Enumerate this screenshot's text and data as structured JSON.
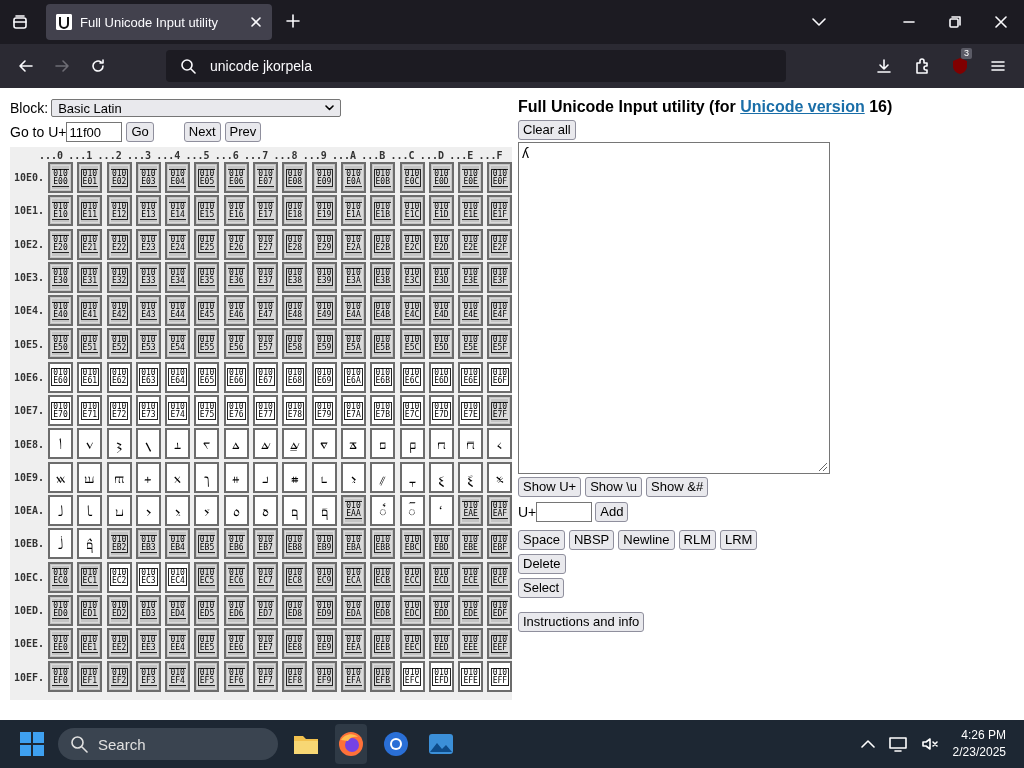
{
  "browser": {
    "tab_title": "Full Unicode Input utility",
    "address": "unicode jkorpela",
    "extension_badge": "3"
  },
  "tool": {
    "block_label": "Block:",
    "block_value": "Basic Latin",
    "goto_label": "Go to U+",
    "goto_value": "11f00",
    "goto_button": "Go",
    "nav_buttons": [
      "Next",
      "Prev"
    ]
  },
  "grid": {
    "columns": [
      "...0",
      "...1",
      "...2",
      "...3",
      "...4",
      "...5",
      "...6",
      "...7",
      "...8",
      "...9",
      "...A",
      "...B",
      "...C",
      "...D",
      "...E",
      "...F"
    ],
    "rows": [
      {
        "label": "10E0.",
        "cells": [
          {
            "kind": "tofu",
            "code": "010E00",
            "assigned": false
          },
          {
            "kind": "tofu",
            "code": "010E01",
            "assigned": false
          },
          {
            "kind": "tofu",
            "code": "010E02",
            "assigned": false
          },
          {
            "kind": "tofu",
            "code": "010E03",
            "assigned": false
          },
          {
            "kind": "tofu",
            "code": "010E04",
            "assigned": false
          },
          {
            "kind": "tofu",
            "code": "010E05",
            "assigned": false
          },
          {
            "kind": "tofu",
            "code": "010E06",
            "assigned": false
          },
          {
            "kind": "tofu",
            "code": "010E07",
            "assigned": false
          },
          {
            "kind": "tofu",
            "code": "010E08",
            "assigned": false
          },
          {
            "kind": "tofu",
            "code": "010E09",
            "assigned": false
          },
          {
            "kind": "tofu",
            "code": "010E0A",
            "assigned": false
          },
          {
            "kind": "tofu",
            "code": "010E0B",
            "assigned": false
          },
          {
            "kind": "tofu",
            "code": "010E0C",
            "assigned": false
          },
          {
            "kind": "tofu",
            "code": "010E0D",
            "assigned": false
          },
          {
            "kind": "tofu",
            "code": "010E0E",
            "assigned": false
          },
          {
            "kind": "tofu",
            "code": "010E0F",
            "assigned": false
          }
        ]
      },
      {
        "label": "10E1.",
        "cells": [
          {
            "kind": "tofu",
            "code": "010E10",
            "assigned": false
          },
          {
            "kind": "tofu",
            "code": "010E11",
            "assigned": false
          },
          {
            "kind": "tofu",
            "code": "010E12",
            "assigned": false
          },
          {
            "kind": "tofu",
            "code": "010E13",
            "assigned": false
          },
          {
            "kind": "tofu",
            "code": "010E14",
            "assigned": false
          },
          {
            "kind": "tofu",
            "code": "010E15",
            "assigned": false
          },
          {
            "kind": "tofu",
            "code": "010E16",
            "assigned": false
          },
          {
            "kind": "tofu",
            "code": "010E17",
            "assigned": false
          },
          {
            "kind": "tofu",
            "code": "010E18",
            "assigned": false
          },
          {
            "kind": "tofu",
            "code": "010E19",
            "assigned": false
          },
          {
            "kind": "tofu",
            "code": "010E1A",
            "assigned": false
          },
          {
            "kind": "tofu",
            "code": "010E1B",
            "assigned": false
          },
          {
            "kind": "tofu",
            "code": "010E1C",
            "assigned": false
          },
          {
            "kind": "tofu",
            "code": "010E1D",
            "assigned": false
          },
          {
            "kind": "tofu",
            "code": "010E1E",
            "assigned": false
          },
          {
            "kind": "tofu",
            "code": "010E1F",
            "assigned": false
          }
        ]
      },
      {
        "label": "10E2.",
        "cells": [
          {
            "kind": "tofu",
            "code": "010E20",
            "assigned": false
          },
          {
            "kind": "tofu",
            "code": "010E21",
            "assigned": false
          },
          {
            "kind": "tofu",
            "code": "010E22",
            "assigned": false
          },
          {
            "kind": "tofu",
            "code": "010E23",
            "assigned": false
          },
          {
            "kind": "tofu",
            "code": "010E24",
            "assigned": false
          },
          {
            "kind": "tofu",
            "code": "010E25",
            "assigned": false
          },
          {
            "kind": "tofu",
            "code": "010E26",
            "assigned": false
          },
          {
            "kind": "tofu",
            "code": "010E27",
            "assigned": false
          },
          {
            "kind": "tofu",
            "code": "010E28",
            "assigned": false
          },
          {
            "kind": "tofu",
            "code": "010E29",
            "assigned": false
          },
          {
            "kind": "tofu",
            "code": "010E2A",
            "assigned": false
          },
          {
            "kind": "tofu",
            "code": "010E2B",
            "assigned": false
          },
          {
            "kind": "tofu",
            "code": "010E2C",
            "assigned": false
          },
          {
            "kind": "tofu",
            "code": "010E2D",
            "assigned": false
          },
          {
            "kind": "tofu",
            "code": "010E2E",
            "assigned": false
          },
          {
            "kind": "tofu",
            "code": "010E2F",
            "assigned": false
          }
        ]
      },
      {
        "label": "10E3.",
        "cells": [
          {
            "kind": "tofu",
            "code": "010E30",
            "assigned": false
          },
          {
            "kind": "tofu",
            "code": "010E31",
            "assigned": false
          },
          {
            "kind": "tofu",
            "code": "010E32",
            "assigned": false
          },
          {
            "kind": "tofu",
            "code": "010E33",
            "assigned": false
          },
          {
            "kind": "tofu",
            "code": "010E34",
            "assigned": false
          },
          {
            "kind": "tofu",
            "code": "010E35",
            "assigned": false
          },
          {
            "kind": "tofu",
            "code": "010E36",
            "assigned": false
          },
          {
            "kind": "tofu",
            "code": "010E37",
            "assigned": false
          },
          {
            "kind": "tofu",
            "code": "010E38",
            "assigned": false
          },
          {
            "kind": "tofu",
            "code": "010E39",
            "assigned": false
          },
          {
            "kind": "tofu",
            "code": "010E3A",
            "assigned": false
          },
          {
            "kind": "tofu",
            "code": "010E3B",
            "assigned": false
          },
          {
            "kind": "tofu",
            "code": "010E3C",
            "assigned": false
          },
          {
            "kind": "tofu",
            "code": "010E3D",
            "assigned": false
          },
          {
            "kind": "tofu",
            "code": "010E3E",
            "assigned": false
          },
          {
            "kind": "tofu",
            "code": "010E3F",
            "assigned": false
          }
        ]
      },
      {
        "label": "10E4.",
        "cells": [
          {
            "kind": "tofu",
            "code": "010E40",
            "assigned": false
          },
          {
            "kind": "tofu",
            "code": "010E41",
            "assigned": false
          },
          {
            "kind": "tofu",
            "code": "010E42",
            "assigned": false
          },
          {
            "kind": "tofu",
            "code": "010E43",
            "assigned": false
          },
          {
            "kind": "tofu",
            "code": "010E44",
            "assigned": false
          },
          {
            "kind": "tofu",
            "code": "010E45",
            "assigned": false
          },
          {
            "kind": "tofu",
            "code": "010E46",
            "assigned": false
          },
          {
            "kind": "tofu",
            "code": "010E47",
            "assigned": false
          },
          {
            "kind": "tofu",
            "code": "010E48",
            "assigned": false
          },
          {
            "kind": "tofu",
            "code": "010E49",
            "assigned": false
          },
          {
            "kind": "tofu",
            "code": "010E4A",
            "assigned": false
          },
          {
            "kind": "tofu",
            "code": "010E4B",
            "assigned": false
          },
          {
            "kind": "tofu",
            "code": "010E4C",
            "assigned": false
          },
          {
            "kind": "tofu",
            "code": "010E4D",
            "assigned": false
          },
          {
            "kind": "tofu",
            "code": "010E4E",
            "assigned": false
          },
          {
            "kind": "tofu",
            "code": "010E4F",
            "assigned": false
          }
        ]
      },
      {
        "label": "10E5.",
        "cells": [
          {
            "kind": "tofu",
            "code": "010E50",
            "assigned": false
          },
          {
            "kind": "tofu",
            "code": "010E51",
            "assigned": false
          },
          {
            "kind": "tofu",
            "code": "010E52",
            "assigned": false
          },
          {
            "kind": "tofu",
            "code": "010E53",
            "assigned": false
          },
          {
            "kind": "tofu",
            "code": "010E54",
            "assigned": false
          },
          {
            "kind": "tofu",
            "code": "010E55",
            "assigned": false
          },
          {
            "kind": "tofu",
            "code": "010E56",
            "assigned": false
          },
          {
            "kind": "tofu",
            "code": "010E57",
            "assigned": false
          },
          {
            "kind": "tofu",
            "code": "010E58",
            "assigned": false
          },
          {
            "kind": "tofu",
            "code": "010E59",
            "assigned": false
          },
          {
            "kind": "tofu",
            "code": "010E5A",
            "assigned": false
          },
          {
            "kind": "tofu",
            "code": "010E5B",
            "assigned": false
          },
          {
            "kind": "tofu",
            "code": "010E5C",
            "assigned": false
          },
          {
            "kind": "tofu",
            "code": "010E5D",
            "assigned": false
          },
          {
            "kind": "tofu",
            "code": "010E5E",
            "assigned": false
          },
          {
            "kind": "tofu",
            "code": "010E5F",
            "assigned": false
          }
        ]
      },
      {
        "label": "10E6.",
        "cells": [
          {
            "kind": "tofu",
            "code": "010E60",
            "assigned": true
          },
          {
            "kind": "tofu",
            "code": "010E61",
            "assigned": true
          },
          {
            "kind": "tofu",
            "code": "010E62",
            "assigned": true
          },
          {
            "kind": "tofu",
            "code": "010E63",
            "assigned": true
          },
          {
            "kind": "tofu",
            "code": "010E64",
            "assigned": true
          },
          {
            "kind": "tofu",
            "code": "010E65",
            "assigned": true
          },
          {
            "kind": "tofu",
            "code": "010E66",
            "assigned": true
          },
          {
            "kind": "tofu",
            "code": "010E67",
            "assigned": true
          },
          {
            "kind": "tofu",
            "code": "010E68",
            "assigned": true
          },
          {
            "kind": "tofu",
            "code": "010E69",
            "assigned": true
          },
          {
            "kind": "tofu",
            "code": "010E6A",
            "assigned": true
          },
          {
            "kind": "tofu",
            "code": "010E6B",
            "assigned": true
          },
          {
            "kind": "tofu",
            "code": "010E6C",
            "assigned": true
          },
          {
            "kind": "tofu",
            "code": "010E6D",
            "assigned": true
          },
          {
            "kind": "tofu",
            "code": "010E6E",
            "assigned": true
          },
          {
            "kind": "tofu",
            "code": "010E6F",
            "assigned": true
          }
        ]
      },
      {
        "label": "10E7.",
        "cells": [
          {
            "kind": "tofu",
            "code": "010E70",
            "assigned": true
          },
          {
            "kind": "tofu",
            "code": "010E71",
            "assigned": true
          },
          {
            "kind": "tofu",
            "code": "010E72",
            "assigned": true
          },
          {
            "kind": "tofu",
            "code": "010E73",
            "assigned": true
          },
          {
            "kind": "tofu",
            "code": "010E74",
            "assigned": true
          },
          {
            "kind": "tofu",
            "code": "010E75",
            "assigned": true
          },
          {
            "kind": "tofu",
            "code": "010E76",
            "assigned": true
          },
          {
            "kind": "tofu",
            "code": "010E77",
            "assigned": true
          },
          {
            "kind": "tofu",
            "code": "010E78",
            "assigned": true
          },
          {
            "kind": "tofu",
            "code": "010E79",
            "assigned": true
          },
          {
            "kind": "tofu",
            "code": "010E7A",
            "assigned": true
          },
          {
            "kind": "tofu",
            "code": "010E7B",
            "assigned": true
          },
          {
            "kind": "tofu",
            "code": "010E7C",
            "assigned": true
          },
          {
            "kind": "tofu",
            "code": "010E7D",
            "assigned": true
          },
          {
            "kind": "tofu",
            "code": "010E7E",
            "assigned": true
          },
          {
            "kind": "tofu",
            "code": "010E7F",
            "assigned": false
          }
        ]
      },
      {
        "label": "10E8.",
        "cells": [
          {
            "kind": "glyph",
            "char": "𐺀",
            "assigned": true
          },
          {
            "kind": "glyph",
            "char": "𐺁",
            "assigned": true
          },
          {
            "kind": "glyph",
            "char": "𐺂",
            "assigned": true
          },
          {
            "kind": "glyph",
            "char": "𐺃",
            "assigned": true
          },
          {
            "kind": "glyph",
            "char": "𐺄",
            "assigned": true
          },
          {
            "kind": "glyph",
            "char": "𐺅",
            "assigned": true
          },
          {
            "kind": "glyph",
            "char": "𐺆",
            "assigned": true
          },
          {
            "kind": "glyph",
            "char": "𐺇",
            "assigned": true
          },
          {
            "kind": "glyph",
            "char": "𐺈",
            "assigned": true
          },
          {
            "kind": "glyph",
            "char": "𐺉",
            "assigned": true
          },
          {
            "kind": "glyph",
            "char": "𐺊",
            "assigned": true
          },
          {
            "kind": "glyph",
            "char": "𐺋",
            "assigned": true
          },
          {
            "kind": "glyph",
            "char": "𐺌",
            "assigned": true
          },
          {
            "kind": "glyph",
            "char": "𐺍",
            "assigned": true
          },
          {
            "kind": "glyph",
            "char": "𐺎",
            "assigned": true
          },
          {
            "kind": "glyph",
            "char": "𐺏",
            "assigned": true
          }
        ]
      },
      {
        "label": "10E9.",
        "cells": [
          {
            "kind": "glyph",
            "char": "𐺐",
            "assigned": true
          },
          {
            "kind": "glyph",
            "char": "𐺑",
            "assigned": true
          },
          {
            "kind": "glyph",
            "char": "𐺒",
            "assigned": true
          },
          {
            "kind": "glyph",
            "char": "𐺓",
            "assigned": true
          },
          {
            "kind": "glyph",
            "char": "𐺔",
            "assigned": true
          },
          {
            "kind": "glyph",
            "char": "𐺕",
            "assigned": true
          },
          {
            "kind": "glyph",
            "char": "𐺖",
            "assigned": true
          },
          {
            "kind": "glyph",
            "char": "𐺗",
            "assigned": true
          },
          {
            "kind": "glyph",
            "char": "𐺘",
            "assigned": true
          },
          {
            "kind": "glyph",
            "char": "𐺙",
            "assigned": true
          },
          {
            "kind": "glyph",
            "char": "𐺚",
            "assigned": true
          },
          {
            "kind": "glyph",
            "char": "𐺛",
            "assigned": true
          },
          {
            "kind": "glyph",
            "char": "𐺜",
            "assigned": true
          },
          {
            "kind": "glyph",
            "char": "𐺝",
            "assigned": true
          },
          {
            "kind": "glyph",
            "char": "𐺞",
            "assigned": true
          },
          {
            "kind": "glyph",
            "char": "𐺟",
            "assigned": true
          }
        ]
      },
      {
        "label": "10EA.",
        "cells": [
          {
            "kind": "glyph",
            "char": "𐺠",
            "assigned": true
          },
          {
            "kind": "glyph",
            "char": "𐺡",
            "assigned": true
          },
          {
            "kind": "glyph",
            "char": "𐺢",
            "assigned": true
          },
          {
            "kind": "glyph",
            "char": "𐺣",
            "assigned": true
          },
          {
            "kind": "glyph",
            "char": "𐺤",
            "assigned": true
          },
          {
            "kind": "glyph",
            "char": "𐺥",
            "assigned": true
          },
          {
            "kind": "glyph",
            "char": "𐺦",
            "assigned": true
          },
          {
            "kind": "glyph",
            "char": "𐺧",
            "assigned": true
          },
          {
            "kind": "glyph",
            "char": "𐺨",
            "assigned": true
          },
          {
            "kind": "glyph",
            "char": "𐺩",
            "assigned": true
          },
          {
            "kind": "tofu",
            "code": "010EAA",
            "assigned": false
          },
          {
            "kind": "glyph",
            "char": "𐺫",
            "assigned": true
          },
          {
            "kind": "glyph",
            "char": "𐺬",
            "assigned": true
          },
          {
            "kind": "glyph",
            "char": "𐺭",
            "assigned": true
          },
          {
            "kind": "tofu",
            "code": "010EAE",
            "assigned": false
          },
          {
            "kind": "tofu",
            "code": "010EAF",
            "assigned": false
          }
        ]
      },
      {
        "label": "10EB.",
        "cells": [
          {
            "kind": "glyph",
            "char": "𐺰",
            "assigned": true
          },
          {
            "kind": "glyph",
            "char": "𐺱",
            "assigned": true
          },
          {
            "kind": "tofu",
            "code": "010EB2",
            "assigned": false
          },
          {
            "kind": "tofu",
            "code": "010EB3",
            "assigned": false
          },
          {
            "kind": "tofu",
            "code": "010EB4",
            "assigned": false
          },
          {
            "kind": "tofu",
            "code": "010EB5",
            "assigned": false
          },
          {
            "kind": "tofu",
            "code": "010EB6",
            "assigned": false
          },
          {
            "kind": "tofu",
            "code": "010EB7",
            "assigned": false
          },
          {
            "kind": "tofu",
            "code": "010EB8",
            "assigned": false
          },
          {
            "kind": "tofu",
            "code": "010EB9",
            "assigned": false
          },
          {
            "kind": "tofu",
            "code": "010EBA",
            "assigned": false
          },
          {
            "kind": "tofu",
            "code": "010EBB",
            "assigned": false
          },
          {
            "kind": "tofu",
            "code": "010EBC",
            "assigned": false
          },
          {
            "kind": "tofu",
            "code": "010EBD",
            "assigned": false
          },
          {
            "kind": "tofu",
            "code": "010EBE",
            "assigned": false
          },
          {
            "kind": "tofu",
            "code": "010EBF",
            "assigned": false
          }
        ]
      },
      {
        "label": "10EC.",
        "cells": [
          {
            "kind": "tofu",
            "code": "010EC0",
            "assigned": false
          },
          {
            "kind": "tofu",
            "code": "010EC1",
            "assigned": false
          },
          {
            "kind": "tofu",
            "code": "010EC2",
            "assigned": true
          },
          {
            "kind": "tofu",
            "code": "010EC3",
            "assigned": true
          },
          {
            "kind": "tofu",
            "code": "010EC4",
            "assigned": true
          },
          {
            "kind": "tofu",
            "code": "010EC5",
            "assigned": false
          },
          {
            "kind": "tofu",
            "code": "010EC6",
            "assigned": false
          },
          {
            "kind": "tofu",
            "code": "010EC7",
            "assigned": false
          },
          {
            "kind": "tofu",
            "code": "010EC8",
            "assigned": false
          },
          {
            "kind": "tofu",
            "code": "010EC9",
            "assigned": false
          },
          {
            "kind": "tofu",
            "code": "010ECA",
            "assigned": false
          },
          {
            "kind": "tofu",
            "code": "010ECB",
            "assigned": false
          },
          {
            "kind": "tofu",
            "code": "010ECC",
            "assigned": false
          },
          {
            "kind": "tofu",
            "code": "010ECD",
            "assigned": false
          },
          {
            "kind": "tofu",
            "code": "010ECE",
            "assigned": false
          },
          {
            "kind": "tofu",
            "code": "010ECF",
            "assigned": false
          }
        ]
      },
      {
        "label": "10ED.",
        "cells": [
          {
            "kind": "tofu",
            "code": "010ED0",
            "assigned": false
          },
          {
            "kind": "tofu",
            "code": "010ED1",
            "assigned": false
          },
          {
            "kind": "tofu",
            "code": "010ED2",
            "assigned": false
          },
          {
            "kind": "tofu",
            "code": "010ED3",
            "assigned": false
          },
          {
            "kind": "tofu",
            "code": "010ED4",
            "assigned": false
          },
          {
            "kind": "tofu",
            "code": "010ED5",
            "assigned": false
          },
          {
            "kind": "tofu",
            "code": "010ED6",
            "assigned": false
          },
          {
            "kind": "tofu",
            "code": "010ED7",
            "assigned": false
          },
          {
            "kind": "tofu",
            "code": "010ED8",
            "assigned": false
          },
          {
            "kind": "tofu",
            "code": "010ED9",
            "assigned": false
          },
          {
            "kind": "tofu",
            "code": "010EDA",
            "assigned": false
          },
          {
            "kind": "tofu",
            "code": "010EDB",
            "assigned": false
          },
          {
            "kind": "tofu",
            "code": "010EDC",
            "assigned": false
          },
          {
            "kind": "tofu",
            "code": "010EDD",
            "assigned": false
          },
          {
            "kind": "tofu",
            "code": "010EDE",
            "assigned": false
          },
          {
            "kind": "tofu",
            "code": "010EDF",
            "assigned": false
          }
        ]
      },
      {
        "label": "10EE.",
        "cells": [
          {
            "kind": "tofu",
            "code": "010EE0",
            "assigned": false
          },
          {
            "kind": "tofu",
            "code": "010EE1",
            "assigned": false
          },
          {
            "kind": "tofu",
            "code": "010EE2",
            "assigned": false
          },
          {
            "kind": "tofu",
            "code": "010EE3",
            "assigned": false
          },
          {
            "kind": "tofu",
            "code": "010EE4",
            "assigned": false
          },
          {
            "kind": "tofu",
            "code": "010EE5",
            "assigned": false
          },
          {
            "kind": "tofu",
            "code": "010EE6",
            "assigned": false
          },
          {
            "kind": "tofu",
            "code": "010EE7",
            "assigned": false
          },
          {
            "kind": "tofu",
            "code": "010EE8",
            "assigned": false
          },
          {
            "kind": "tofu",
            "code": "010EE9",
            "assigned": false
          },
          {
            "kind": "tofu",
            "code": "010EEA",
            "assigned": false
          },
          {
            "kind": "tofu",
            "code": "010EEB",
            "assigned": false
          },
          {
            "kind": "tofu",
            "code": "010EEC",
            "assigned": false
          },
          {
            "kind": "tofu",
            "code": "010EED",
            "assigned": false
          },
          {
            "kind": "tofu",
            "code": "010EEE",
            "assigned": false
          },
          {
            "kind": "tofu",
            "code": "010EEF",
            "assigned": false
          }
        ]
      },
      {
        "label": "10EF.",
        "cells": [
          {
            "kind": "tofu",
            "code": "010EF0",
            "assigned": false
          },
          {
            "kind": "tofu",
            "code": "010EF1",
            "assigned": false
          },
          {
            "kind": "tofu",
            "code": "010EF2",
            "assigned": false
          },
          {
            "kind": "tofu",
            "code": "010EF3",
            "assigned": false
          },
          {
            "kind": "tofu",
            "code": "010EF4",
            "assigned": false
          },
          {
            "kind": "tofu",
            "code": "010EF5",
            "assigned": false
          },
          {
            "kind": "tofu",
            "code": "010EF6",
            "assigned": false
          },
          {
            "kind": "tofu",
            "code": "010EF7",
            "assigned": false
          },
          {
            "kind": "tofu",
            "code": "010EF8",
            "assigned": false
          },
          {
            "kind": "tofu",
            "code": "010EF9",
            "assigned": false
          },
          {
            "kind": "tofu",
            "code": "010EFA",
            "assigned": false
          },
          {
            "kind": "tofu",
            "code": "010EFB",
            "assigned": false
          },
          {
            "kind": "tofu",
            "code": "010EFC",
            "assigned": true
          },
          {
            "kind": "tofu",
            "code": "010EFD",
            "assigned": true
          },
          {
            "kind": "tofu",
            "code": "010EFE",
            "assigned": true
          },
          {
            "kind": "tofu",
            "code": "010EFF",
            "assigned": true
          }
        ]
      }
    ]
  },
  "panel": {
    "title_before": "Full Unicode Input utility (for ",
    "title_link": "Unicode version",
    "title_after": " 16)",
    "clear_button": "Clear all",
    "text_value": "ʎ",
    "show_buttons": [
      "Show U+",
      "Show \\u",
      "Show &#"
    ],
    "add_label": "U+",
    "add_button": "Add",
    "insert_buttons": [
      "Space",
      "NBSP",
      "Newline",
      "RLM",
      "LRM"
    ],
    "delete_button": "Delete",
    "select_button": "Select",
    "info_button": "Instructions and info"
  },
  "taskbar": {
    "search_placeholder": "Search",
    "time": "4:26 PM",
    "date": "2/23/2025"
  }
}
